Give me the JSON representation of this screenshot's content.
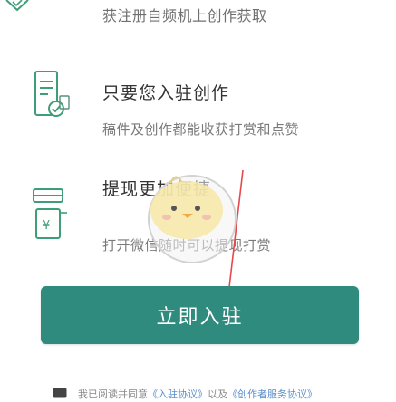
{
  "colors": {
    "accent": "#2e8b7d",
    "icon_green": "#3e9e7a",
    "arrow": "#e5484d"
  },
  "items": [
    {
      "icon": "badge-check-icon",
      "text": "获注册自频机上创作获取"
    },
    {
      "icon": "document-check-icon",
      "title": "只要您入驻创作",
      "subtitle": "稿件及创作都能收获打赏和点赞"
    },
    {
      "icon": "wallet-yuan-icon",
      "title": "提现更加便捷",
      "subtitle": "打开微信随时可以提现打赏",
      "symbol": "¥"
    }
  ],
  "button": {
    "label": "立即入驻"
  },
  "agreement": {
    "prefix": "我已阅读并同意",
    "link1": "《入驻协议》",
    "middle": "以及",
    "link2": "《创作者服务协议》"
  }
}
